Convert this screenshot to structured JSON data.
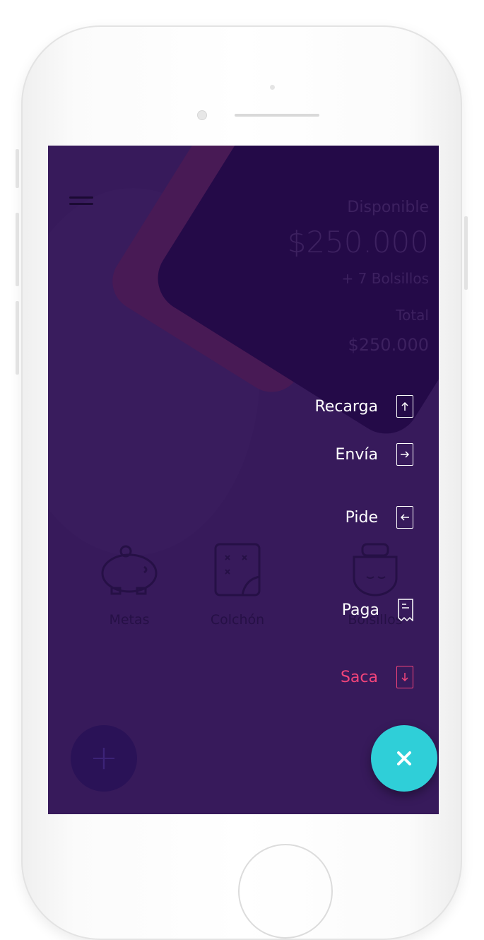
{
  "header": {
    "menu_icon": "hamburger-icon"
  },
  "balance": {
    "available_label": "Disponible",
    "available_amount": "$250.000",
    "pockets": "+ 7 Bolsillos",
    "total_label": "Total",
    "total_amount": "$250.000"
  },
  "shortcuts": [
    {
      "label": "Metas",
      "icon": "piggy-bank-icon"
    },
    {
      "label": "Colchón",
      "icon": "mattress-icon"
    },
    {
      "label": "Bolsillos",
      "icon": "bag-icon"
    }
  ],
  "actions": [
    {
      "label": "Recarga",
      "icon": "arrow-up-icon"
    },
    {
      "label": "Envía",
      "icon": "arrow-right-icon"
    },
    {
      "label": "Pide",
      "icon": "arrow-left-icon"
    },
    {
      "label": "Paga",
      "icon": "receipt-icon"
    },
    {
      "label": "Saca",
      "icon": "arrow-down-icon"
    }
  ],
  "buttons": {
    "add_icon": "plus-icon",
    "close_icon": "close-icon"
  },
  "colors": {
    "background": "#371a5b",
    "card": "#240a48",
    "accent_cyan": "#2fcfd8",
    "accent_pink": "#f2447a"
  }
}
